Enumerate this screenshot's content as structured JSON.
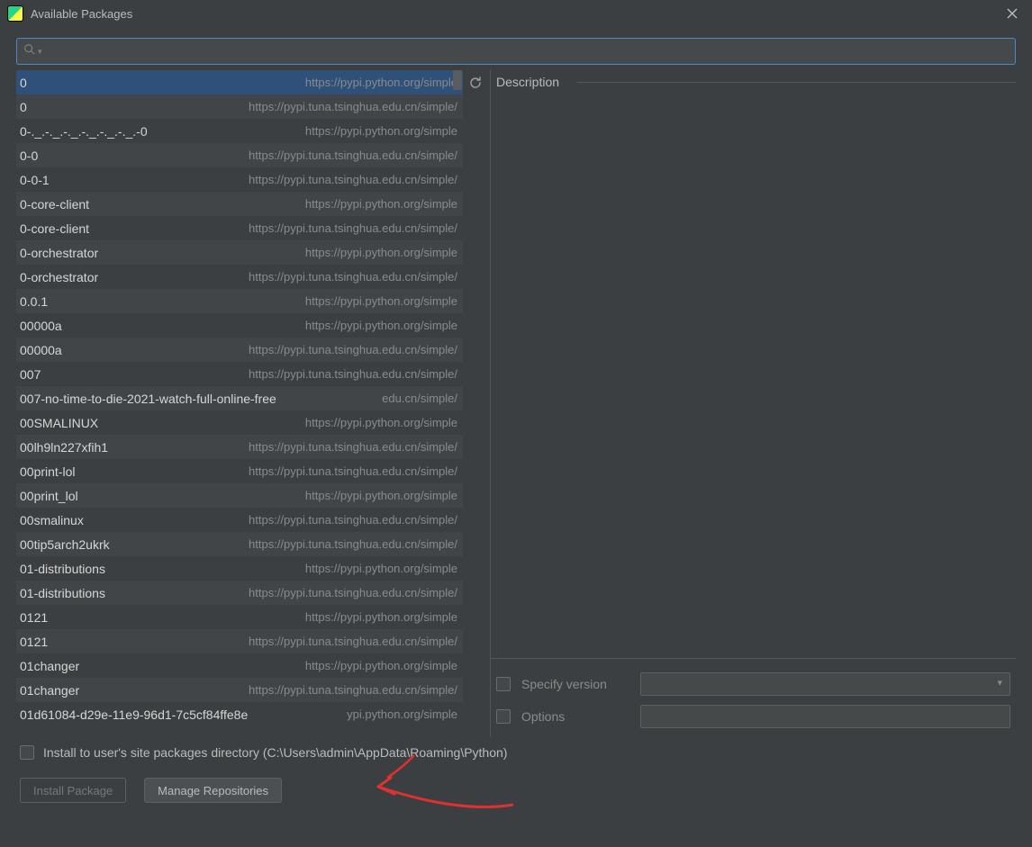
{
  "window": {
    "title": "Available Packages"
  },
  "search": {
    "value": "",
    "placeholder": ""
  },
  "description_label": "Description",
  "specify_version_label": "Specify version",
  "specify_version_value": "",
  "options_label": "Options",
  "options_value": "",
  "install_to_user_label": "Install to user's site packages directory (C:\\Users\\admin\\AppData\\Roaming\\Python)",
  "buttons": {
    "install": "Install Package",
    "manage": "Manage Repositories"
  },
  "packages": [
    {
      "name": "0",
      "repo": "https://pypi.python.org/simple",
      "selected": true
    },
    {
      "name": "0",
      "repo": "https://pypi.tuna.tsinghua.edu.cn/simple/"
    },
    {
      "name": "0-._.-._.-._.-._.-._.-._.-0",
      "repo": "https://pypi.python.org/simple"
    },
    {
      "name": "0-0",
      "repo": "https://pypi.tuna.tsinghua.edu.cn/simple/"
    },
    {
      "name": "0-0-1",
      "repo": "https://pypi.tuna.tsinghua.edu.cn/simple/"
    },
    {
      "name": "0-core-client",
      "repo": "https://pypi.python.org/simple"
    },
    {
      "name": "0-core-client",
      "repo": "https://pypi.tuna.tsinghua.edu.cn/simple/"
    },
    {
      "name": "0-orchestrator",
      "repo": "https://pypi.python.org/simple"
    },
    {
      "name": "0-orchestrator",
      "repo": "https://pypi.tuna.tsinghua.edu.cn/simple/"
    },
    {
      "name": "0.0.1",
      "repo": "https://pypi.python.org/simple"
    },
    {
      "name": "00000a",
      "repo": "https://pypi.python.org/simple"
    },
    {
      "name": "00000a",
      "repo": "https://pypi.tuna.tsinghua.edu.cn/simple/"
    },
    {
      "name": "007",
      "repo": "https://pypi.tuna.tsinghua.edu.cn/simple/"
    },
    {
      "name": "007-no-time-to-die-2021-watch-full-online-free",
      "repo": "edu.cn/simple/"
    },
    {
      "name": "00SMALINUX",
      "repo": "https://pypi.python.org/simple"
    },
    {
      "name": "00lh9ln227xfih1",
      "repo": "https://pypi.tuna.tsinghua.edu.cn/simple/"
    },
    {
      "name": "00print-lol",
      "repo": "https://pypi.tuna.tsinghua.edu.cn/simple/"
    },
    {
      "name": "00print_lol",
      "repo": "https://pypi.python.org/simple"
    },
    {
      "name": "00smalinux",
      "repo": "https://pypi.tuna.tsinghua.edu.cn/simple/"
    },
    {
      "name": "00tip5arch2ukrk",
      "repo": "https://pypi.tuna.tsinghua.edu.cn/simple/"
    },
    {
      "name": "01-distributions",
      "repo": "https://pypi.python.org/simple"
    },
    {
      "name": "01-distributions",
      "repo": "https://pypi.tuna.tsinghua.edu.cn/simple/"
    },
    {
      "name": "0121",
      "repo": "https://pypi.python.org/simple"
    },
    {
      "name": "0121",
      "repo": "https://pypi.tuna.tsinghua.edu.cn/simple/"
    },
    {
      "name": "01changer",
      "repo": "https://pypi.python.org/simple"
    },
    {
      "name": "01changer",
      "repo": "https://pypi.tuna.tsinghua.edu.cn/simple/"
    },
    {
      "name": "01d61084-d29e-11e9-96d1-7c5cf84ffe8e",
      "repo": "ypi.python.org/simple"
    }
  ]
}
